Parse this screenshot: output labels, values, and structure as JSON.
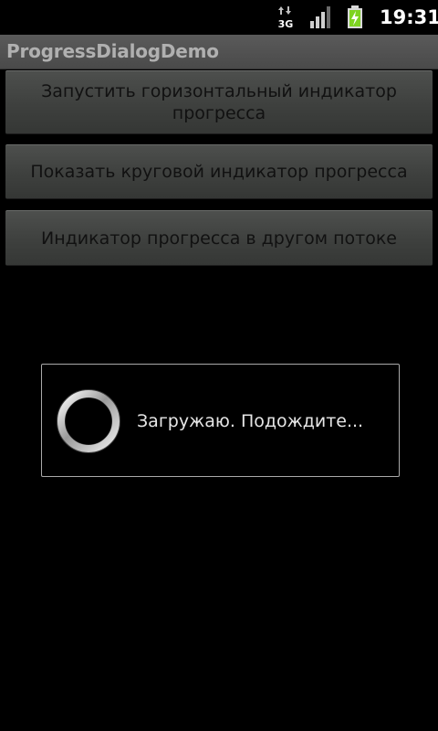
{
  "status_bar": {
    "network_type": "3G",
    "network_icon": "data-arrows-3g-icon",
    "signal_icon": "signal-strength-icon",
    "battery_icon": "battery-charging-icon",
    "time": "19:31",
    "battery_color": "#7ed321"
  },
  "title_bar": {
    "title": "ProgressDialogDemo"
  },
  "buttons": [
    {
      "label": "Запустить горизонтальный индикатор прогресса"
    },
    {
      "label": "Показать круговой индикатор прогресса"
    },
    {
      "label": "Индикатор прогресса в другом потоке"
    }
  ],
  "dialog": {
    "message": "Загружаю. Подождите...",
    "spinner_icon": "loading-spinner-icon"
  }
}
